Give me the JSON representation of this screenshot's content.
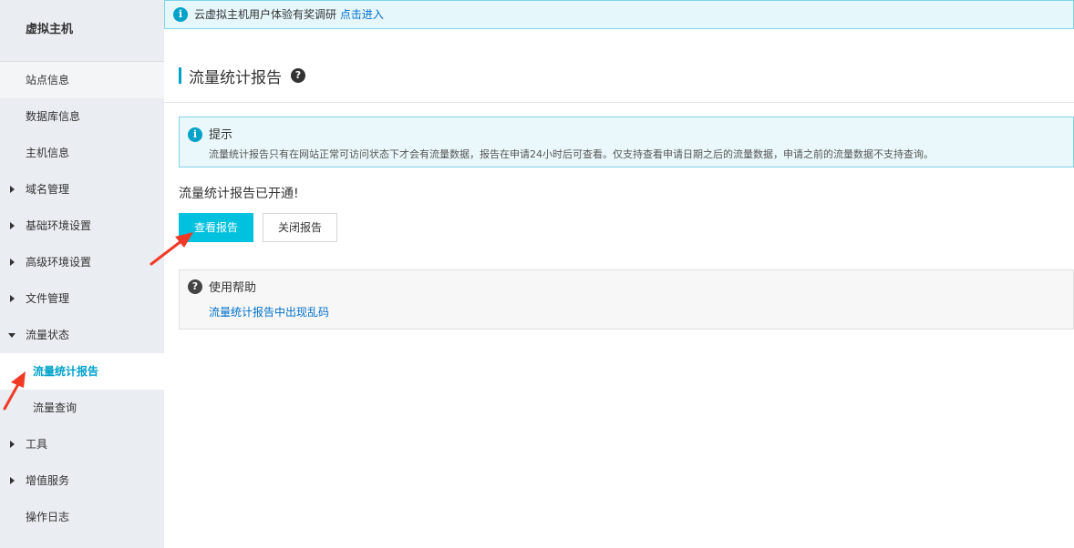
{
  "sidebar": {
    "title": "虚拟主机",
    "items": [
      {
        "label": "站点信息"
      },
      {
        "label": "数据库信息"
      },
      {
        "label": "主机信息"
      },
      {
        "label": "域名管理"
      },
      {
        "label": "基础环境设置"
      },
      {
        "label": "高级环境设置"
      },
      {
        "label": "文件管理"
      },
      {
        "label": "流量状态"
      },
      {
        "label": "流量统计报告"
      },
      {
        "label": "流量查询"
      },
      {
        "label": "工具"
      },
      {
        "label": "增值服务"
      },
      {
        "label": "操作日志"
      }
    ]
  },
  "notice": {
    "text": "云虚拟主机用户体验有奖调研",
    "link": "点击进入"
  },
  "page": {
    "title": "流量统计报告"
  },
  "tip": {
    "title": "提示",
    "text": "流量统计报告只有在网站正常可访问状态下才会有流量数据，报告在申请24小时后可查看。仅支持查看申请日期之后的流量数据，申请之前的流量数据不支持查询。"
  },
  "status": {
    "text": "流量统计报告已开通!"
  },
  "buttons": {
    "view": "查看报告",
    "close": "关闭报告"
  },
  "help": {
    "title": "使用帮助",
    "link": "流量统计报告中出现乱码"
  },
  "colors": {
    "accent": "#00c1de",
    "link": "#0070cc",
    "annotation": "#f03a26"
  }
}
